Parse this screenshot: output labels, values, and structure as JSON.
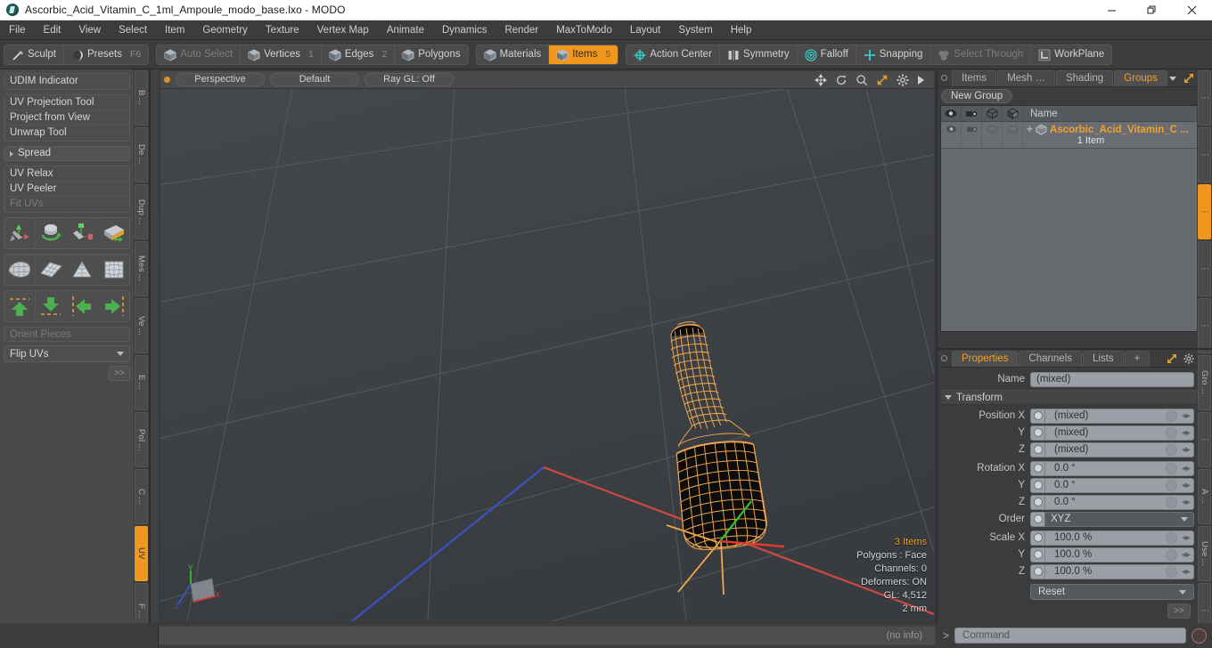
{
  "window": {
    "title": "Ascorbic_Acid_Vitamin_C_1ml_Ampoule_modo_base.lxo - MODO",
    "minimize": "—",
    "maximize": "❐",
    "close": "✕"
  },
  "menubar": {
    "items": [
      {
        "label": "File"
      },
      {
        "label": "Edit"
      },
      {
        "label": "View"
      },
      {
        "label": "Select"
      },
      {
        "label": "Item"
      },
      {
        "label": "Geometry"
      },
      {
        "label": "Texture"
      },
      {
        "label": "Vertex Map"
      },
      {
        "label": "Animate"
      },
      {
        "label": "Dynamics"
      },
      {
        "label": "Render"
      },
      {
        "label": "MaxToModo"
      },
      {
        "label": "Layout"
      },
      {
        "label": "System"
      },
      {
        "label": "Help"
      }
    ]
  },
  "toolbar": {
    "group1": [
      {
        "label": "Sculpt",
        "icon": "brush-icon",
        "state": "normal",
        "num": ""
      },
      {
        "label": "Presets",
        "icon": "sphere-icon",
        "state": "normal",
        "num": "F6"
      }
    ],
    "group2": [
      {
        "label": "Auto Select",
        "icon": "cube-icon",
        "state": "dim",
        "num": ""
      },
      {
        "label": "Vertices",
        "icon": "cube-icon",
        "state": "normal",
        "num": "1"
      },
      {
        "label": "Edges",
        "icon": "cube-icon",
        "state": "normal",
        "num": "2"
      },
      {
        "label": "Polygons",
        "icon": "cube-icon",
        "state": "normal",
        "num": ""
      }
    ],
    "group3": [
      {
        "label": "Materials",
        "icon": "cube-icon",
        "state": "normal",
        "num": ""
      },
      {
        "label": "Items",
        "icon": "cube-icon",
        "state": "active",
        "num": "5"
      }
    ],
    "group4": [
      {
        "label": "Action Center",
        "icon": "action-center-icon",
        "state": "normal",
        "num": ""
      },
      {
        "label": "Symmetry",
        "icon": "symmetry-icon",
        "state": "normal",
        "num": ""
      },
      {
        "label": "Falloff",
        "icon": "falloff-icon",
        "state": "normal",
        "num": ""
      },
      {
        "label": "Snapping",
        "icon": "snapping-icon",
        "state": "normal",
        "num": ""
      },
      {
        "label": "Select Through",
        "icon": "select-through-icon",
        "state": "dim",
        "num": ""
      },
      {
        "label": "WorkPlane",
        "icon": "workplane-icon",
        "state": "normal",
        "num": ""
      }
    ]
  },
  "left_panel": {
    "udim": "UDIM Indicator",
    "uv_tools": [
      "UV Projection Tool",
      "Project from View",
      "Unwrap Tool"
    ],
    "spread_header": "Spread",
    "relax_tools": [
      {
        "label": "UV Relax",
        "dim": false
      },
      {
        "label": "UV Peeler",
        "dim": false
      },
      {
        "label": "Fit UVs",
        "dim": true
      }
    ],
    "icon_row1": [
      "move-uv-icon",
      "rotate-uv-icon",
      "scale-uv-icon",
      "fit-uv-icon"
    ],
    "icon_row2": [
      "unwrap-shell-icon",
      "uv-grid-icon",
      "uv-cone-icon",
      "uv-sphere-icon"
    ],
    "icon_row3": [
      "arrow-up-icon",
      "arrow-down-icon",
      "arrow-left-icon",
      "arrow-right-icon"
    ],
    "orient_pieces": "Orient Pieces",
    "flip_uvs": "Flip UVs",
    "more_label": ">>",
    "tabs": [
      {
        "label": "B ...",
        "active": false
      },
      {
        "label": "De ...",
        "active": false
      },
      {
        "label": "Dup ...",
        "active": false
      },
      {
        "label": "Mes ...",
        "active": false
      },
      {
        "label": "Ve ...",
        "active": false
      },
      {
        "label": "E ...",
        "active": false
      },
      {
        "label": "Pol ...",
        "active": false
      },
      {
        "label": "C ...",
        "active": false
      },
      {
        "label": "UV",
        "active": true
      },
      {
        "label": "F ...",
        "active": false
      }
    ]
  },
  "viewport": {
    "pills": [
      "Perspective",
      "Default",
      "Ray GL: Off"
    ],
    "header_icons": [
      "move-view-icon",
      "rotate-view-icon",
      "zoom-view-icon",
      "maximize-view-icon",
      "gear-icon",
      "chevron-right-icon"
    ],
    "info": {
      "items": "3 Items",
      "polygons": "Polygons : Face",
      "channels": "Channels: 0",
      "deformers": "Deformers: ON",
      "gl": "GL: 4,512",
      "scale": "2 mm"
    },
    "axis_labels": {
      "x": "X",
      "y": "Y",
      "z": "Z"
    }
  },
  "right_panel": {
    "tabs": [
      {
        "label": "Items",
        "active": false
      },
      {
        "label": "Mesh …",
        "active": false
      },
      {
        "label": "Shading",
        "active": false
      },
      {
        "label": "Groups",
        "active": true
      }
    ],
    "tab_icons": [
      "chevron-down-icon",
      "expand-icon",
      "chevron-right-icon"
    ],
    "new_group_button": "New Group",
    "list": {
      "columns": [
        "eye-icon",
        "render-camera-icon",
        "wireframe-cube-icon",
        "shaded-cube-icon"
      ],
      "name_header": "Name",
      "rows": [
        {
          "expander": "+",
          "icon": "mesh-item-icon",
          "name": "Ascorbic_Acid_Vitamin_C ...",
          "sub": "1 Item"
        }
      ]
    }
  },
  "properties": {
    "tabs": [
      {
        "label": "Properties",
        "active": true
      },
      {
        "label": "Channels",
        "active": false
      },
      {
        "label": "Lists",
        "active": false
      },
      {
        "label": "+",
        "active": false
      }
    ],
    "tab_icons": [
      "expand-icon",
      "gear-icon",
      "chevron-right-icon"
    ],
    "name_label": "Name",
    "name_value": "(mixed)",
    "transform_header": "Transform",
    "position": {
      "label": "Position X",
      "rows": [
        {
          "label": "Position X",
          "value": "(mixed)"
        },
        {
          "label": "Y",
          "value": "(mixed)"
        },
        {
          "label": "Z",
          "value": "(mixed)"
        }
      ]
    },
    "rotation": {
      "rows": [
        {
          "label": "Rotation X",
          "value": "0.0 °"
        },
        {
          "label": "Y",
          "value": "0.0 °"
        },
        {
          "label": "Z",
          "value": "0.0 °"
        }
      ]
    },
    "order": {
      "label": "Order",
      "value": "XYZ"
    },
    "scale": {
      "rows": [
        {
          "label": "Scale X",
          "value": "100.0 %"
        },
        {
          "label": "Y",
          "value": "100.0 %"
        },
        {
          "label": "Z",
          "value": "100.0 %"
        }
      ]
    },
    "reset": "Reset",
    "more_label": ">>",
    "side_tabs": [
      {
        "label": "⋮",
        "active": false
      },
      {
        "label": "⋮",
        "active": false
      },
      {
        "label": "⋮",
        "active": true
      },
      {
        "label": "⋮",
        "active": false
      },
      {
        "label": "⋮",
        "active": false
      },
      {
        "label": "Gro ...",
        "active": false
      },
      {
        "label": "⋮",
        "active": false
      },
      {
        "label": "A ...",
        "active": false
      },
      {
        "label": "Use ...",
        "active": false
      },
      {
        "label": "⋮",
        "active": false
      }
    ]
  },
  "statusbar": {
    "info": "(no info)",
    "command_caret": ">",
    "command_placeholder": "Command"
  },
  "colors": {
    "accent": "#f09720",
    "wireframe": "#f0a64a",
    "axis_x": "#c83232",
    "axis_y": "#32a032",
    "axis_z": "#3250c8",
    "panel_bg": "#3c3c3c",
    "viewport_bg": "#3f4346"
  }
}
